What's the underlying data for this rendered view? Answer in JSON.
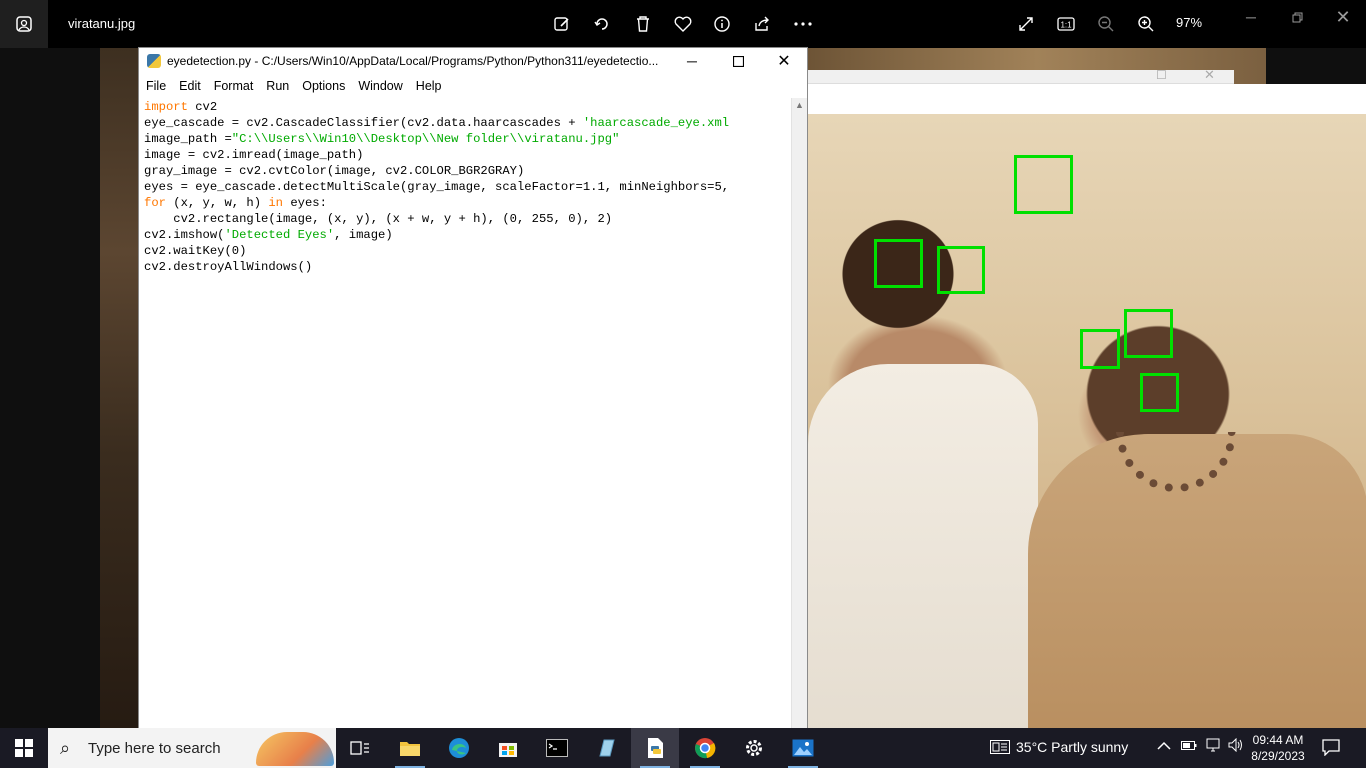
{
  "photos": {
    "file_name": "viratanu.jpg",
    "zoom": "97%",
    "toolbar_icons": [
      "edit-icon",
      "rotate-icon",
      "delete-icon",
      "favorite-icon",
      "info-icon",
      "share-icon",
      "more-icon",
      "fullscreen-icon",
      "actual-size-icon",
      "zoom-out-icon",
      "zoom-in-icon"
    ]
  },
  "idle": {
    "title": "eyedetection.py - C:/Users/Win10/AppData/Local/Programs/Python/Python311/eyedetectio...",
    "menu": [
      "File",
      "Edit",
      "Format",
      "Run",
      "Options",
      "Window",
      "Help"
    ],
    "code": {
      "l1_kw": "import",
      "l1_rest": " cv2",
      "l2_pre": "eye_cascade = cv2.CascadeClassifier(cv2.data.haarcascades + ",
      "l2_str": "'haarcascade_eye.xml",
      "l3_pre": "image_path =",
      "l3_str": "\"C:\\\\Users\\\\Win10\\\\Desktop\\\\New folder\\\\viratanu.jpg\"",
      "l4": "image = cv2.imread(image_path)",
      "l5": "gray_image = cv2.cvtColor(image, cv2.COLOR_BGR2GRAY)",
      "l6": "eyes = eye_cascade.detectMultiScale(gray_image, scaleFactor=1.1, minNeighbors=5,",
      "l7_kw1": "for",
      "l7_mid": " (x, y, w, h) ",
      "l7_kw2": "in",
      "l7_rest": " eyes:",
      "l8": "    cv2.rectangle(image, (x, y), (x + w, y + h), (0, 255, 0), 2)",
      "l9_pre": "cv2.imshow(",
      "l9_str": "'Detected Eyes'",
      "l9_rest": ", image)",
      "l10": "cv2.waitKey(0)",
      "l11": "cv2.destroyAllWindows()"
    }
  },
  "taskbar": {
    "search_placeholder": "Type here to search",
    "weather": "35°C  Partly sunny",
    "time": "09:44 AM",
    "date": "8/29/2023"
  },
  "colors": {
    "detection_box": "#00e000",
    "keyword": "#ff7700",
    "string": "#00aa00"
  }
}
